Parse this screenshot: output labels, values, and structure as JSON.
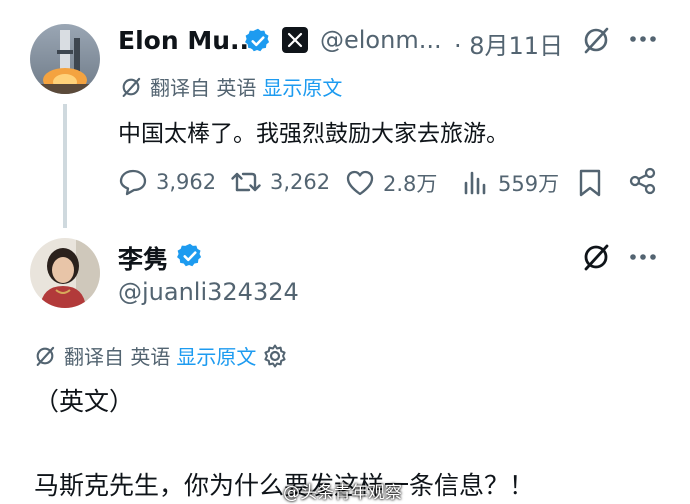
{
  "tweet1": {
    "author_name": "Elon Mu...",
    "handle": "@elonm...",
    "date": "· 8月11日",
    "translate_label": "翻译自 英语",
    "show_original": "显示原文",
    "text": "中国太棒了。我强烈鼓励大家去旅游。",
    "replies": "3,962",
    "retweets": "3,262",
    "likes": "2.8万",
    "views": "559万"
  },
  "tweet2": {
    "author_name": "李隽",
    "handle": "@juanli324324",
    "translate_label": "翻译自 英语",
    "show_original": "显示原文",
    "text_line1": "（英文）",
    "text_line2": "马斯克先生，你为什么要发这样一条信息？！"
  },
  "watermark": "@头条青年观察",
  "colors": {
    "verified": "#1d9bf0",
    "muted": "#536471",
    "link": "#1d9bf0",
    "thread_line": "#cfd9de"
  }
}
